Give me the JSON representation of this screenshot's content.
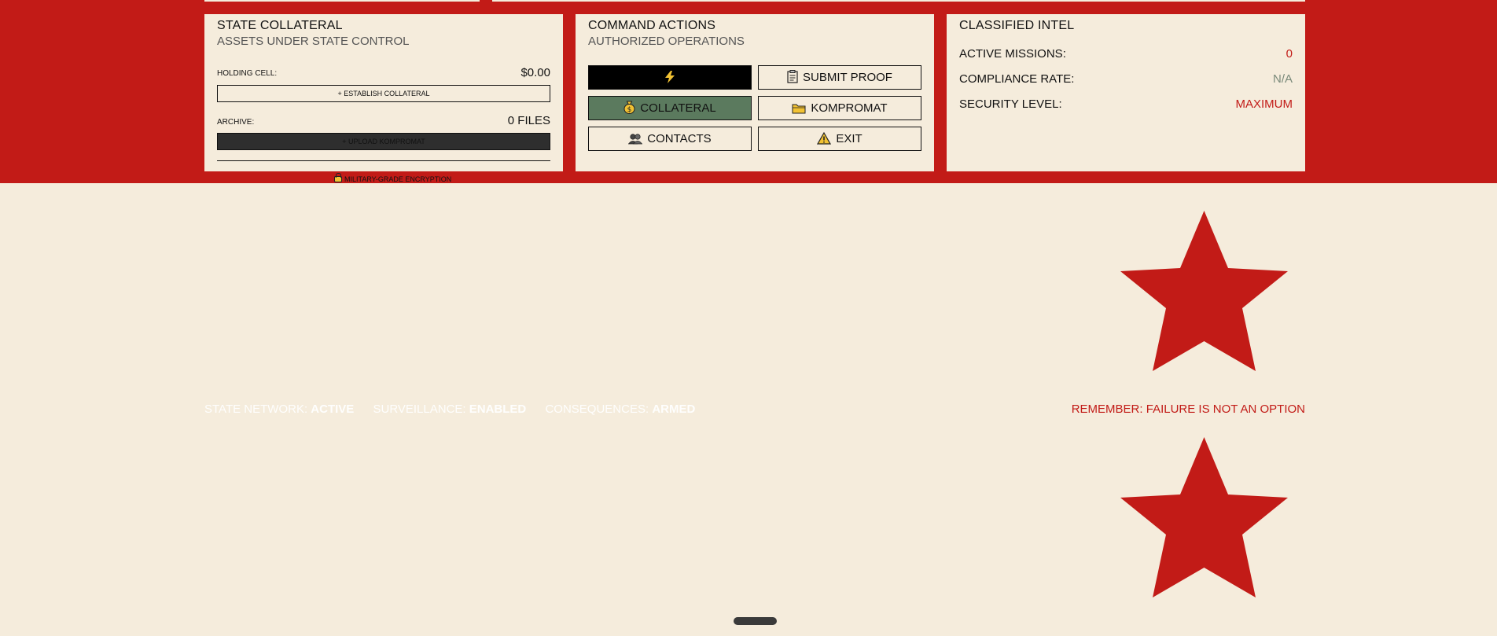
{
  "collateral": {
    "title": "STATE COLLATERAL",
    "subtitle": "ASSETS UNDER STATE CONTROL",
    "holding_label": "HOLDING CELL:",
    "holding_value": "$0.00",
    "establish_button": "+ ESTABLISH COLLATERAL",
    "archive_label": "ARCHIVE:",
    "archive_value": "0 FILES",
    "upload_button": "+ UPLOAD KOMPROMAT",
    "encryption_note": "MILITARY-GRADE ENCRYPTION"
  },
  "command": {
    "title": "COMMAND ACTIONS",
    "subtitle": "AUTHORIZED OPERATIONS",
    "buttons": {
      "quick_icon": "lightning-icon",
      "submit_proof": "SUBMIT PROOF",
      "collateral": "COLLATERAL",
      "kompromat": "KOMPROMAT",
      "contacts": "CONTACTS",
      "exit": "EXIT"
    }
  },
  "intel": {
    "title": "CLASSIFIED INTEL",
    "rows": [
      {
        "label": "ACTIVE MISSIONS:",
        "value": "0",
        "color": "#c21b17"
      },
      {
        "label": "COMPLIANCE RATE:",
        "value": "N/A",
        "color": "#7a8a7a"
      },
      {
        "label": "SECURITY LEVEL:",
        "value": "MAXIMUM",
        "color": "#c21b17"
      }
    ]
  },
  "status": {
    "network_label": "STATE NETWORK:",
    "network_value": "ACTIVE",
    "surveillance_label": "SURVEILLANCE:",
    "surveillance_value": "ENABLED",
    "consequences_label": "CONSEQUENCES:",
    "consequences_value": "ARMED",
    "remember": "REMEMBER: FAILURE IS NOT AN OPTION"
  },
  "colors": {
    "brand_red": "#c21b17",
    "cream": "#f5ecdc",
    "action_green": "#5b7a5e",
    "warning_yellow": "#f2c233"
  }
}
